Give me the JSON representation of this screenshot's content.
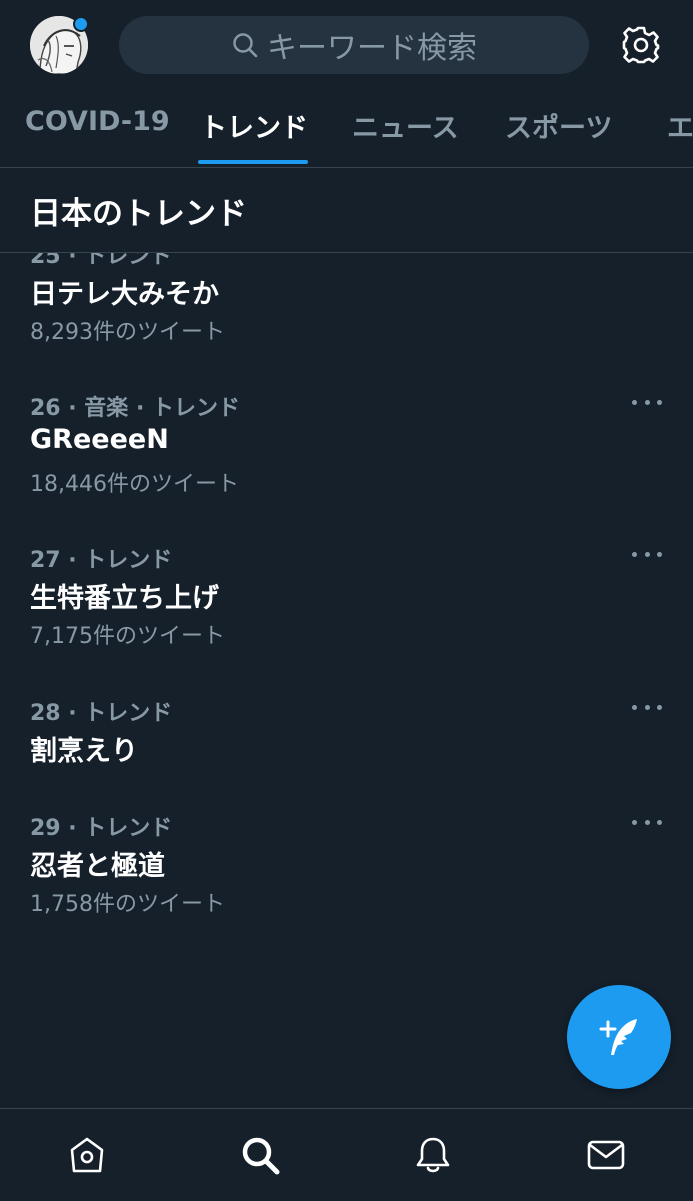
{
  "header": {
    "search_placeholder": "キーワード検索"
  },
  "tabs": [
    {
      "label": "COVID-19",
      "active": false
    },
    {
      "label": "トレンド",
      "active": true
    },
    {
      "label": "ニュース",
      "active": false
    },
    {
      "label": "スポーツ",
      "active": false
    },
    {
      "label": "エ",
      "active": false
    }
  ],
  "section": {
    "title": "日本のトレンド"
  },
  "trends": [
    {
      "meta": "25 · トレンド",
      "name": "日テレ大みそか",
      "count": "8,293件のツイート"
    },
    {
      "meta": "26 · 音楽 · トレンド",
      "name": "GReeeeN",
      "count": "18,446件のツイート"
    },
    {
      "meta": "27 · トレンド",
      "name": "生特番立ち上げ",
      "count": "7,175件のツイート"
    },
    {
      "meta": "28 · トレンド",
      "name": "割烹えり",
      "count": ""
    },
    {
      "meta": "29 · トレンド",
      "name": "忍者と極道",
      "count": "1,758件のツイート"
    }
  ],
  "colors": {
    "background": "#15202b",
    "accent": "#1d9bf0",
    "secondary_text": "#8899a6",
    "divider": "#38444d"
  },
  "icons": {
    "search": "search-icon",
    "settings": "gear-icon",
    "more": "more-horizontal-icon",
    "compose": "compose-tweet-icon",
    "home": "home-icon",
    "explore": "search-icon",
    "notifications": "bell-icon",
    "messages": "mail-icon"
  }
}
